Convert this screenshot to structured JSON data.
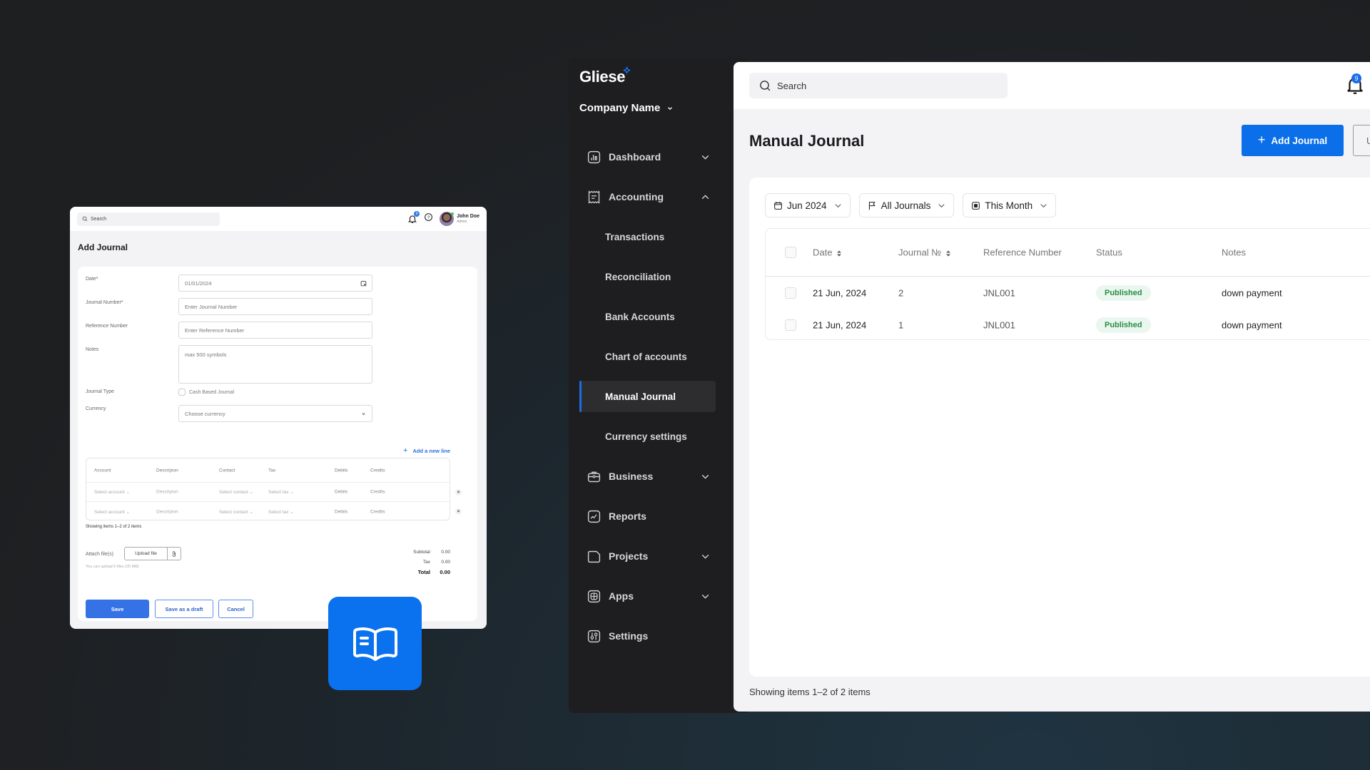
{
  "colors": {
    "accent": "#0a6fe8",
    "sidebar_bg": "#1e1e20",
    "status_published_bg": "#eaf7ee",
    "status_published_text": "#2c8a4a"
  },
  "add_journal_window": {
    "search_placeholder": "Search",
    "notification_count": "9",
    "user": {
      "name": "John Doe",
      "role": "Admin"
    },
    "title": "Add Journal",
    "form": {
      "date_label": "Date*",
      "date_value": "01/01/2024",
      "journal_number_label": "Journal Number*",
      "journal_number_placeholder": "Enter Journal Number",
      "reference_number_label": "Reference Number",
      "reference_number_placeholder": "Enter Reference Number",
      "notes_label": "Notes",
      "notes_placeholder": "max 500 symbols",
      "journal_type_label": "Journal Type",
      "journal_type_checkbox": "Cash Based Journal",
      "currency_label": "Currency",
      "currency_placeholder": "Choose currency"
    },
    "add_line_label": "Add a new line",
    "lines_table": {
      "headers": [
        "Account",
        "Descripion",
        "Contact",
        "Tax",
        "Debits",
        "Credits"
      ],
      "rows": [
        [
          "Select account",
          "Descripion",
          "Select contact",
          "Select tax",
          "Debits",
          "Credits"
        ],
        [
          "Select account",
          "Descripion",
          "Select contact",
          "Select tax",
          "Debits",
          "Credits"
        ]
      ]
    },
    "showing_text": "Showing items 1–2 of 2 items",
    "attach_label": "Attach file(s)",
    "upload_button": "Upload file",
    "upload_hint": "You can upload 5 files (25 MB)",
    "totals": {
      "subtotal_label": "Subtotal",
      "subtotal_value": "0.00",
      "tax_label": "Tax",
      "tax_value": "0.00",
      "total_label": "Total",
      "total_value": "0.00"
    },
    "buttons": {
      "save": "Save",
      "draft": "Save as a draft",
      "cancel": "Cancel"
    }
  },
  "app": {
    "logo": "Gliese",
    "company": "Company Name",
    "nav": [
      {
        "label": "Dashboard",
        "icon": "dashboard-icon",
        "chevron": "down"
      },
      {
        "label": "Accounting",
        "icon": "receipt-icon",
        "chevron": "up"
      },
      {
        "label": "Business",
        "icon": "briefcase-icon",
        "chevron": "down"
      },
      {
        "label": "Reports",
        "icon": "chart-line-icon",
        "chevron": ""
      },
      {
        "label": "Projects",
        "icon": "folder-icon",
        "chevron": "down"
      },
      {
        "label": "Apps",
        "icon": "apps-icon",
        "chevron": "down"
      },
      {
        "label": "Settings",
        "icon": "sliders-icon",
        "chevron": ""
      }
    ],
    "accounting_sub": [
      {
        "label": "Transactions"
      },
      {
        "label": "Reconciliation"
      },
      {
        "label": "Bank Accounts"
      },
      {
        "label": "Chart of accounts"
      },
      {
        "label": "Manual Journal",
        "active": true
      },
      {
        "label": "Currency settings"
      }
    ],
    "search_placeholder": "Search",
    "notification_count": "9",
    "page_title": "Manual Journal",
    "add_button": "Add Journal",
    "secondary_button": "U",
    "filters": [
      {
        "label": "Jun 2024",
        "icon": "calendar-icon"
      },
      {
        "label": "All Journals",
        "icon": "flag-icon"
      },
      {
        "label": "This Month",
        "icon": "calendar-badge-icon"
      }
    ],
    "table": {
      "headers": [
        "Date",
        "Journal №",
        "Reference Number",
        "Status",
        "Notes"
      ],
      "rows": [
        {
          "date": "21 Jun, 2024",
          "journal_no": "2",
          "reference": "JNL001",
          "status": "Published",
          "notes": "down payment"
        },
        {
          "date": "21 Jun, 2024",
          "journal_no": "1",
          "reference": "JNL001",
          "status": "Published",
          "notes": "down payment"
        }
      ]
    },
    "showing_text": "Showing items 1–2 of 2 items"
  }
}
